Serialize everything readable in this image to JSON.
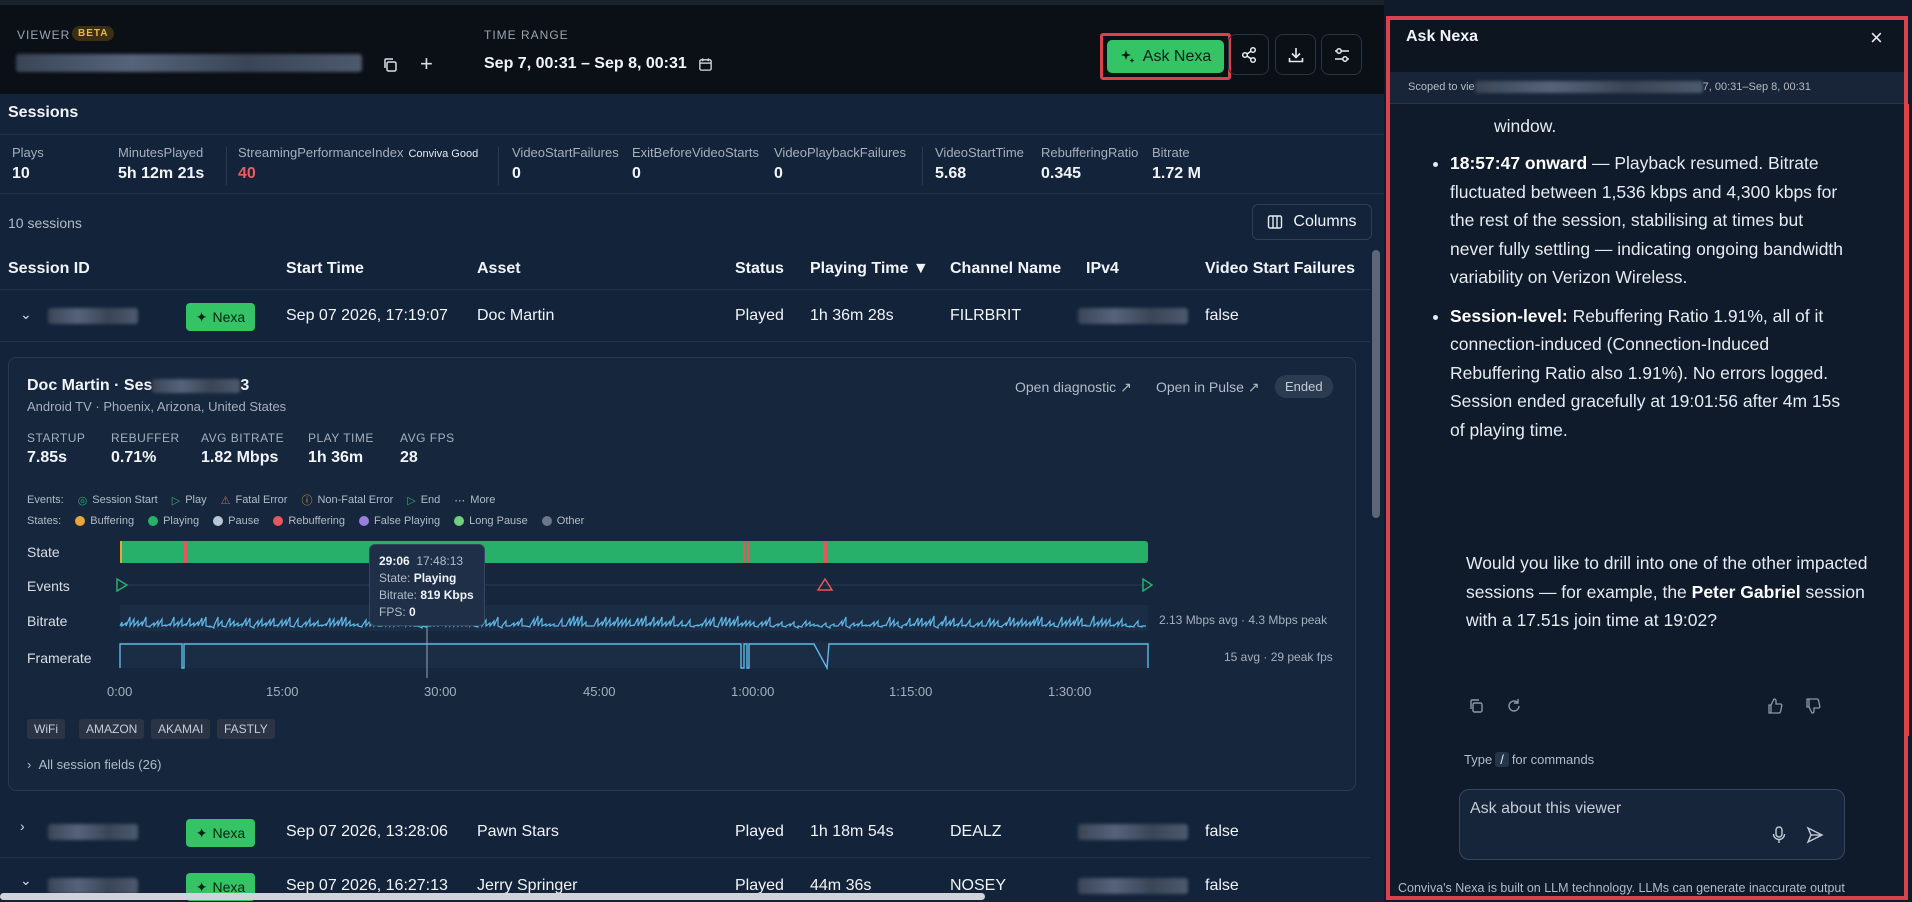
{
  "header": {
    "viewer_label": "VIEWER",
    "beta_badge": "BETA",
    "time_range_label": "TIME RANGE",
    "time_range_value": "Sep 7, 00:31 – Sep 8, 00:31",
    "ask_button": "Ask Nexa"
  },
  "sessions": {
    "title": "Sessions",
    "count_text": "10 sessions",
    "columns_button": "Columns",
    "metrics": [
      {
        "label": "Plays",
        "value": "10"
      },
      {
        "label": "MinutesPlayed",
        "value": "5h 12m 21s"
      },
      {
        "label": "StreamingPerformanceIndex",
        "value": "40",
        "badge": "Conviva Good"
      },
      {
        "label": "VideoStartFailures",
        "value": "0"
      },
      {
        "label": "ExitBeforeVideoStarts",
        "value": "0"
      },
      {
        "label": "VideoPlaybackFailures",
        "value": "0"
      },
      {
        "label": "VideoStartTime",
        "value": "5.68"
      },
      {
        "label": "RebufferingRatio",
        "value": "0.345"
      },
      {
        "label": "Bitrate",
        "value": "1.72 M"
      }
    ],
    "columns": [
      "Session ID",
      "Start Time",
      "Asset",
      "Status",
      "Playing Time ▼",
      "Channel Name",
      "IPv4",
      "Video Start Failures"
    ],
    "nexa_pill": "Nexa",
    "rows": [
      {
        "start": "Sep 07 2026, 17:19:07",
        "asset": "Doc Martin",
        "status": "Played",
        "playing": "1h 36m 28s",
        "channel": "FILRBRIT",
        "vsf": "false"
      },
      {
        "start": "Sep 07 2026, 13:28:06",
        "asset": "Pawn Stars",
        "status": "Played",
        "playing": "1h 18m 54s",
        "channel": "DEALZ",
        "vsf": "false"
      },
      {
        "start": "Sep 07 2026, 16:27:13",
        "asset": "Jerry Springer",
        "status": "Played",
        "playing": "44m 36s",
        "channel": "NOSEY",
        "vsf": "false"
      }
    ]
  },
  "detail": {
    "title": "Doc Martin · Ses",
    "title_tail": "3",
    "subtitle": "Android TV · Phoenix, Arizona, United States",
    "open_diagnostic": "Open diagnostic",
    "open_pulse": "Open in Pulse",
    "ended_badge": "Ended",
    "kpis": [
      {
        "label": "STARTUP",
        "value": "7.85s"
      },
      {
        "label": "REBUFFER",
        "value": "0.71%"
      },
      {
        "label": "AVG BITRATE",
        "value": "1.82 Mbps"
      },
      {
        "label": "PLAY TIME",
        "value": "1h 36m"
      },
      {
        "label": "AVG FPS",
        "value": "28"
      }
    ],
    "events_label": "Events:",
    "events": [
      "Session Start",
      "Play",
      "Fatal Error",
      "Non-Fatal Error",
      "End",
      "More"
    ],
    "states_label": "States:",
    "states": [
      {
        "name": "Buffering",
        "color": "#e8a53a"
      },
      {
        "name": "Playing",
        "color": "#27b06a"
      },
      {
        "name": "Pause",
        "color": "#b9c6d8"
      },
      {
        "name": "Rebuffering",
        "color": "#e5565d"
      },
      {
        "name": "False Playing",
        "color": "#9b7fe0"
      },
      {
        "name": "Long Pause",
        "color": "#6fd07e"
      },
      {
        "name": "Other",
        "color": "#6b7686"
      }
    ],
    "lanes": [
      "State",
      "Events",
      "Bitrate",
      "Framerate"
    ],
    "bitrate_summary": "2.13 Mbps avg · 4.3 Mbps peak",
    "framerate_summary": "15 avg · 29 peak fps",
    "ticks": [
      "0:00",
      "15:00",
      "30:00",
      "45:00",
      "1:00:00",
      "1:15:00",
      "1:30:00"
    ],
    "tooltip": {
      "time": "29:06",
      "clock": "17:48:13",
      "state_label": "State:",
      "state": "Playing",
      "bitrate_label": "Bitrate:",
      "bitrate": "819 Kbps",
      "fps_label": "FPS:",
      "fps": "0"
    },
    "tags": [
      "WiFi",
      "AMAZON",
      "AKAMAI",
      "FASTLY"
    ],
    "all_fields": "All session fields (26)"
  },
  "panel": {
    "title": "Ask Nexa",
    "scope_prefix": "Scoped to vie",
    "scope_suffix": "7, 00:31–Sep 8, 00:31",
    "chat_top": "window.",
    "bullet1_bold": "18:57:47 onward",
    "bullet1_text": " — Playback resumed. Bitrate fluctuated between 1,536 kbps and 4,300 kbps for the rest of the session, stabilising at times but never fully settling — indicating ongoing bandwidth variability on Verizon Wireless.",
    "bullet2_bold": "Session-level:",
    "bullet2_text": " Rebuffering Ratio 1.91%, all of it connection-induced (Connection-Induced Rebuffering Ratio also 1.91%). No errors logged. Session ended gracefully at 19:01:56 after 4m 15s of playing time.",
    "followup_a": "Would you like to drill into one of the other impacted sessions — for example, the ",
    "followup_bold": "Peter Gabriel",
    "followup_b": " session with a 17.51s join time at 19:02?",
    "type_hint_a": "Type",
    "type_hint_slash": "/",
    "type_hint_b": "for commands",
    "input_placeholder": "Ask about this viewer",
    "disclaimer": "Conviva's Nexa is built on LLM technology. LLMs can generate inaccurate output"
  }
}
